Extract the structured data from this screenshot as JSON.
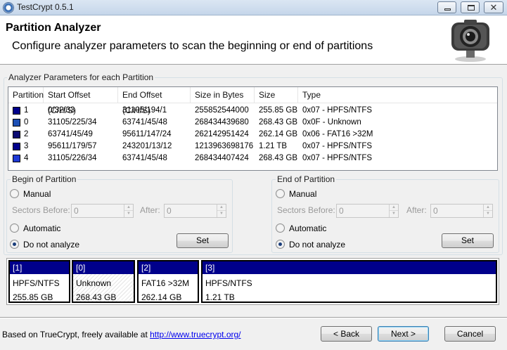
{
  "window": {
    "title": "TestCrypt 0.5.1"
  },
  "header": {
    "title": "Partition Analyzer",
    "subtitle": "Configure analyzer parameters to scan the beginning or end of partitions"
  },
  "params_group": {
    "label": "Analyzer Parameters for each Partition"
  },
  "table": {
    "columns": [
      "Partition",
      "Start Offset (C/H/S)",
      "End Offset (C/H/S)",
      "Size in Bytes",
      "Size",
      "Type"
    ],
    "rows": [
      {
        "partition": "1",
        "start": "0/32/33",
        "end": "31105/194/1",
        "bytes": "255852544000",
        "size": "255.85 GB",
        "type": "0x07 - HPFS/NTFS",
        "color": "#00008b"
      },
      {
        "partition": "0",
        "start": "31105/225/34",
        "end": "63741/45/48",
        "bytes": "268434439680",
        "size": "268.43 GB",
        "type": "0x0F - Unknown",
        "color": "#1c4fb5"
      },
      {
        "partition": "2",
        "start": "63741/45/49",
        "end": "95611/147/24",
        "bytes": "262142951424",
        "size": "262.14 GB",
        "type": "0x06 - FAT16 >32M",
        "color": "#0a0a72"
      },
      {
        "partition": "3",
        "start": "95611/179/57",
        "end": "243201/13/12",
        "bytes": "1213963698176",
        "size": "1.21 TB",
        "type": "0x07 - HPFS/NTFS",
        "color": "#00008b"
      },
      {
        "partition": "4",
        "start": "31105/226/34",
        "end": "63741/45/48",
        "bytes": "268434407424",
        "size": "268.43 GB",
        "type": "0x07 - HPFS/NTFS",
        "color": "#1f3ad6"
      }
    ]
  },
  "begin": {
    "label": "Begin of Partition",
    "manual": "Manual",
    "sectors_before": "Sectors Before:",
    "sectors_before_value": "0",
    "after": "After:",
    "after_value": "0",
    "automatic": "Automatic",
    "do_not_analyze": "Do not analyze",
    "set": "Set"
  },
  "end": {
    "label": "End of Partition",
    "manual": "Manual",
    "sectors_before": "Sectors Before:",
    "sectors_before_value": "0",
    "after": "After:",
    "after_value": "0",
    "automatic": "Automatic",
    "do_not_analyze": "Do not analyze",
    "set": "Set"
  },
  "map": [
    {
      "id": "[1]",
      "type": "HPFS/NTFS",
      "size": "255.85 GB"
    },
    {
      "id": "[0]",
      "type": "Unknown",
      "size": "268.43 GB"
    },
    {
      "id": "[2]",
      "type": "FAT16 >32M",
      "size": "262.14 GB"
    },
    {
      "id": "[3]",
      "type": "HPFS/NTFS",
      "size": "1.21 TB"
    }
  ],
  "footer": {
    "text": "Based on TrueCrypt, freely available at ",
    "link": "http://www.truecrypt.org/",
    "back": "< Back",
    "next": "Next >",
    "cancel": "Cancel"
  }
}
